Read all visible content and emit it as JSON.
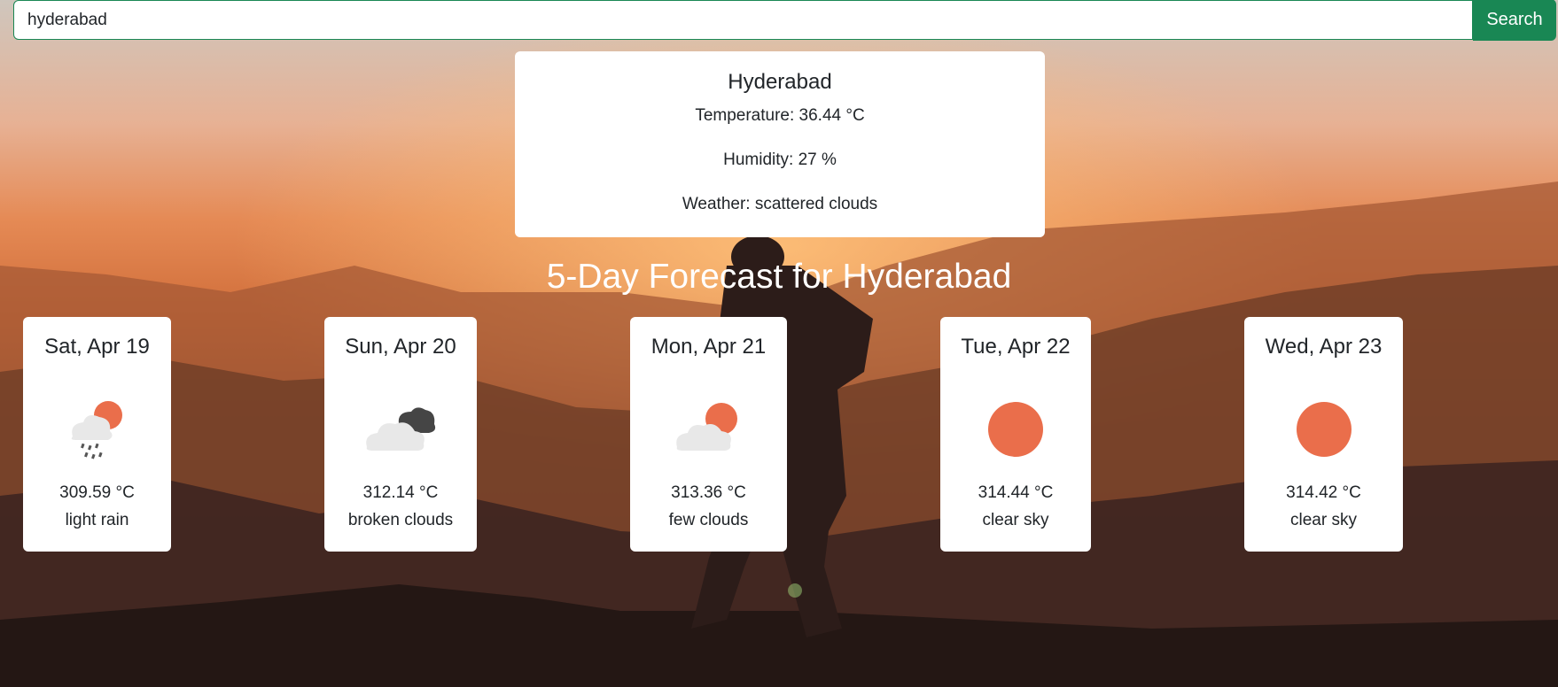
{
  "search": {
    "value": "hyderabad",
    "button_label": "Search"
  },
  "current": {
    "city": "Hyderabad",
    "temperature": "Temperature: 36.44 °C",
    "humidity": "Humidity: 27 %",
    "weather": "Weather: scattered clouds"
  },
  "forecast": {
    "title": "5-Day Forecast for Hyderabad",
    "days": [
      {
        "date": "Sat, Apr 19",
        "icon": "rain-cloud-sun-icon",
        "temp": "309.59 °C",
        "desc": "light rain"
      },
      {
        "date": "Sun, Apr 20",
        "icon": "broken-clouds-icon",
        "temp": "312.14 °C",
        "desc": "broken clouds"
      },
      {
        "date": "Mon, Apr 21",
        "icon": "few-clouds-icon",
        "temp": "313.36 °C",
        "desc": "few clouds"
      },
      {
        "date": "Tue, Apr 22",
        "icon": "clear-sky-sun-icon",
        "temp": "314.44 °C",
        "desc": "clear sky"
      },
      {
        "date": "Wed, Apr 23",
        "icon": "clear-sky-sun-icon",
        "temp": "314.42 °C",
        "desc": "clear sky"
      }
    ]
  },
  "colors": {
    "accent": "#198754",
    "sun": "#ea6e4b"
  }
}
